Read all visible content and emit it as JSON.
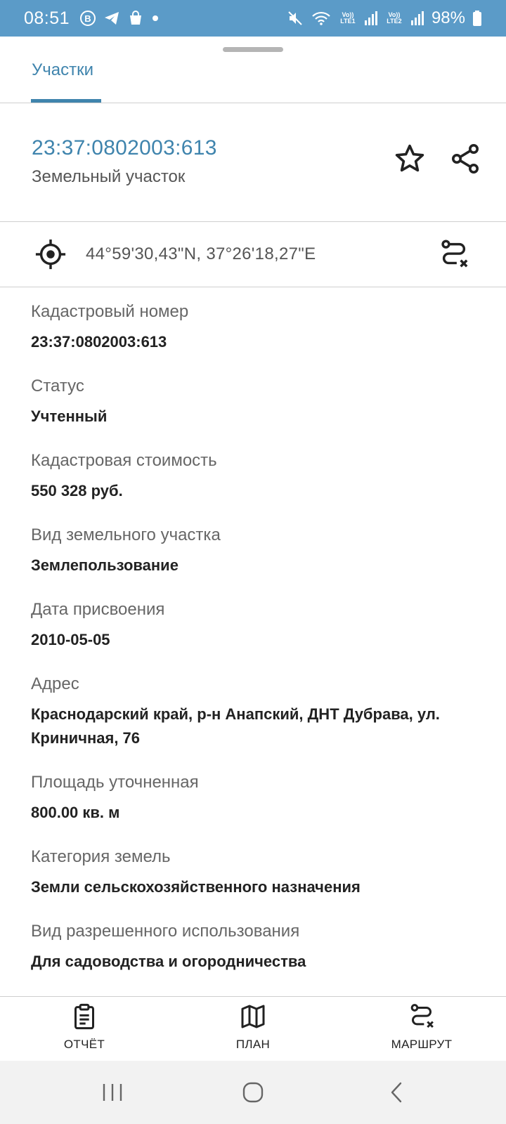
{
  "status_bar": {
    "time": "08:51",
    "icons_left": [
      "vk-icon",
      "telegram-icon",
      "shopping-bag-icon",
      "dot-icon"
    ],
    "network_1": "Vo)) LTE1",
    "network_2": "Vo)) LTE2",
    "battery": "98%"
  },
  "tabs": [
    {
      "label": "Участки",
      "active": true
    }
  ],
  "header": {
    "cadastral_number": "23:37:0802003:613",
    "object_type": "Земельный участок"
  },
  "coordinates": "44°59'30,43\"N, 37°26'18,27\"E",
  "fields": [
    {
      "label": "Кадастровый номер",
      "value": "23:37:0802003:613"
    },
    {
      "label": "Статус",
      "value": "Учтенный"
    },
    {
      "label": "Кадастровая стоимость",
      "value": "550 328 руб."
    },
    {
      "label": "Вид земельного участка",
      "value": "Землепользование"
    },
    {
      "label": "Дата присвоения",
      "value": "2010-05-05"
    },
    {
      "label": "Адрес",
      "value": "Краснодарский край, р-н Анапский, ДНТ Дубрава, ул. Криничная, 76"
    },
    {
      "label": "Площадь уточненная",
      "value": "800.00 кв. м"
    },
    {
      "label": "Категория земель",
      "value": "Земли сельскохозяйственного назначения"
    },
    {
      "label": "Вид разрешенного использования",
      "value": "Для садоводства и огородничества"
    }
  ],
  "bottom_nav": [
    {
      "label": "ОТЧЁТ",
      "icon": "report-icon"
    },
    {
      "label": "ПЛАН",
      "icon": "map-icon"
    },
    {
      "label": "МАРШРУТ",
      "icon": "route-icon"
    }
  ],
  "colors": {
    "status_bar": "#5b9bc8",
    "accent": "#3f84ad"
  }
}
